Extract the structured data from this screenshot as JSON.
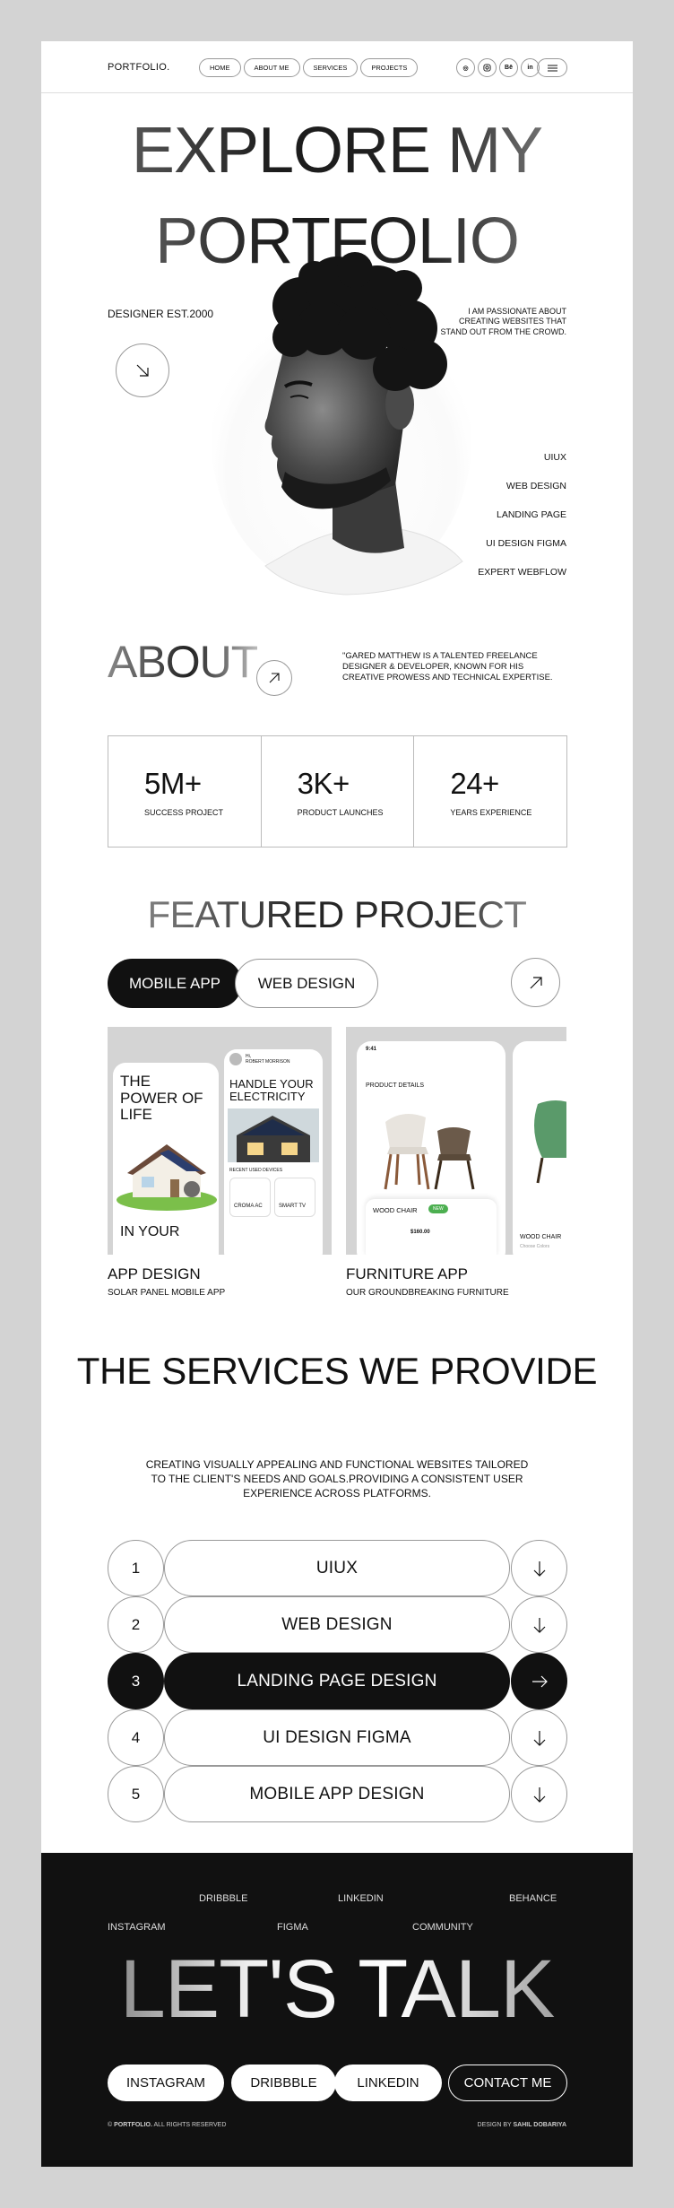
{
  "header": {
    "logo": "PORTFOLIO.",
    "nav": [
      "HOME",
      "ABOUT ME",
      "SERVICES",
      "PROJECTS"
    ],
    "socials": [
      {
        "icon": "dribbble-icon",
        "glyph": "◎"
      },
      {
        "icon": "instagram-icon",
        "glyph": "◻"
      },
      {
        "icon": "behance-icon",
        "glyph": "Bē"
      },
      {
        "icon": "linkedin-icon",
        "glyph": "in"
      }
    ],
    "menu_icon": "menu-icon"
  },
  "hero": {
    "line1": "EXPLORE MY",
    "line2": "PORTFOLIO",
    "est": "DESIGNER EST.2000",
    "passion": "I AM PASSIONATE ABOUT CREATING WEBSITES THAT STAND OUT FROM THE CROWD.",
    "skills": [
      "UIUX",
      "WEB DESIGN",
      "LANDING PAGE",
      "UI DESIGN FIGMA",
      "EXPERT WEBFLOW"
    ]
  },
  "about": {
    "title": "ABOUT",
    "text": "\"GARED MATTHEW IS A TALENTED FREELANCE DESIGNER & DEVELOPER, KNOWN FOR HIS CREATIVE PROWESS AND TECHNICAL EXPERTISE.",
    "stats": [
      {
        "value": "5M+",
        "label": "SUCCESS PROJECT"
      },
      {
        "value": "3K+",
        "label": "PRODUCT LAUNCHES"
      },
      {
        "value": "24+",
        "label": "YEARS EXPERIENCE"
      }
    ]
  },
  "featured": {
    "title": "FEATURED PROJECT",
    "tabs": [
      "MOBILE APP",
      "WEB DESIGN"
    ],
    "projects": [
      {
        "name": "APP DESIGN",
        "subtitle": "SOLAR PANEL MOBILE APP",
        "screen1_title": "THE POWER OF LIFE",
        "screen1_footer": "IN YOUR",
        "screen2_greeting": "Hi,",
        "screen2_user": "ROBERT MORRISON",
        "screen2_title": "HANDLE YOUR ELECTRICITY",
        "screen2_section": "RECENT USED DEVICES",
        "devices": [
          "CROMA AC",
          "SMART TV"
        ]
      },
      {
        "name": "FURNITURE APP",
        "subtitle": "OUR GROUNDBREAKING FURNITURE",
        "time": "9:41",
        "section": "PRODUCT DETAILS",
        "product": "WOOD CHAIR",
        "badge": "NEW",
        "price": "$160.00",
        "product2": "WOOD CHAIR",
        "product2_sub": "Choose Colors"
      }
    ]
  },
  "services": {
    "title": "THE SERVICES WE PROVIDE",
    "description": "CREATING VISUALLY APPEALING AND FUNCTIONAL WEBSITES TAILORED TO THE CLIENT'S NEEDS AND GOALS.PROVIDING A CONSISTENT USER EXPERIENCE ACROSS PLATFORMS.",
    "rows": [
      {
        "num": "1",
        "label": "UIUX",
        "active": false
      },
      {
        "num": "2",
        "label": "WEB DESIGN",
        "active": false
      },
      {
        "num": "3",
        "label": "LANDING PAGE DESIGN",
        "active": true
      },
      {
        "num": "4",
        "label": "UI DESIGN FIGMA",
        "active": false
      },
      {
        "num": "5",
        "label": "MOBILE APP DESIGN",
        "active": false
      }
    ]
  },
  "footer": {
    "links_top": [
      "DRIBBBLE",
      "LINKEDIN",
      "BEHANCE"
    ],
    "links_bottom": [
      "INSTAGRAM",
      "FIGMA",
      "COMMUNITY"
    ],
    "cta": "LET'S TALK",
    "buttons": [
      "INSTAGRAM",
      "DRIBBBLE",
      "LINKEDIN",
      "CONTACT ME"
    ],
    "copyright_prefix": "©",
    "copyright_brand": "PORTFOLIO.",
    "copyright_rest": "ALL RIGHTS RESERVED",
    "credit_prefix": "DESIGN BY",
    "credit_name": "SAHIL DOBARIYA"
  }
}
